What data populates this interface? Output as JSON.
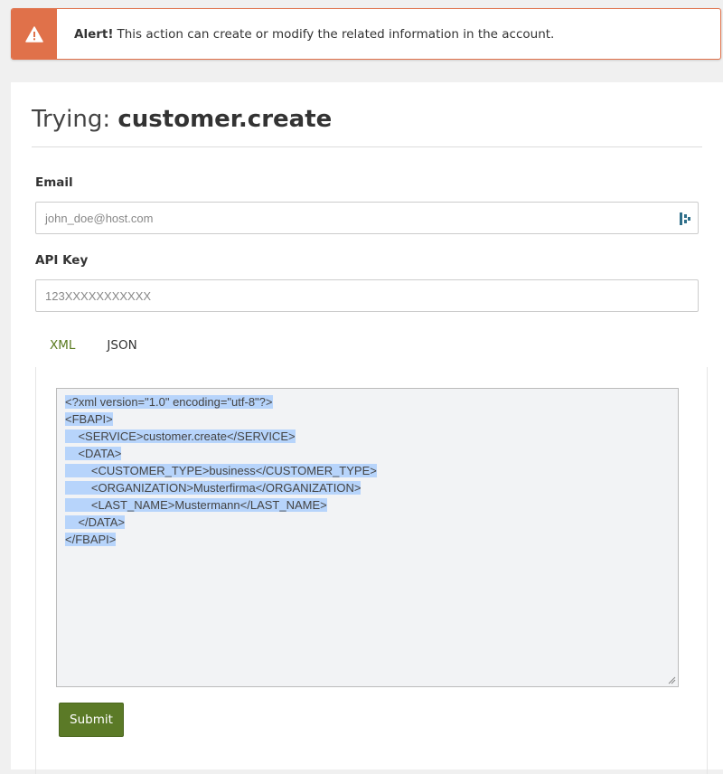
{
  "alert": {
    "title": "Alert!",
    "message": "This action can create or modify the related information in the account.",
    "icon": "warning-triangle-icon",
    "color": "#e0714a"
  },
  "header": {
    "prefix": "Trying:",
    "method": "customer.create"
  },
  "form": {
    "email": {
      "label": "Email",
      "placeholder": "john_doe@host.com"
    },
    "api_key": {
      "label": "API Key",
      "placeholder": "123XXXXXXXXXXX"
    }
  },
  "tabs": [
    {
      "label": "XML",
      "active": true
    },
    {
      "label": "JSON",
      "active": false
    }
  ],
  "code": {
    "lines": [
      "<?xml version=\"1.0\" encoding=\"utf-8\"?>",
      "<FBAPI>",
      "    <SERVICE>customer.create</SERVICE>",
      "    <DATA>",
      "        <CUSTOMER_TYPE>business</CUSTOMER_TYPE>",
      "        <ORGANIZATION>Musterfirma</ORGANIZATION>",
      "        <LAST_NAME>Mustermann</LAST_NAME>",
      "    </DATA>",
      "</FBAPI>"
    ]
  },
  "submit_label": "Submit",
  "colors": {
    "accent": "#5b7a27",
    "active_tab": "#5a7a1f",
    "selection": "#b7d4fb"
  }
}
